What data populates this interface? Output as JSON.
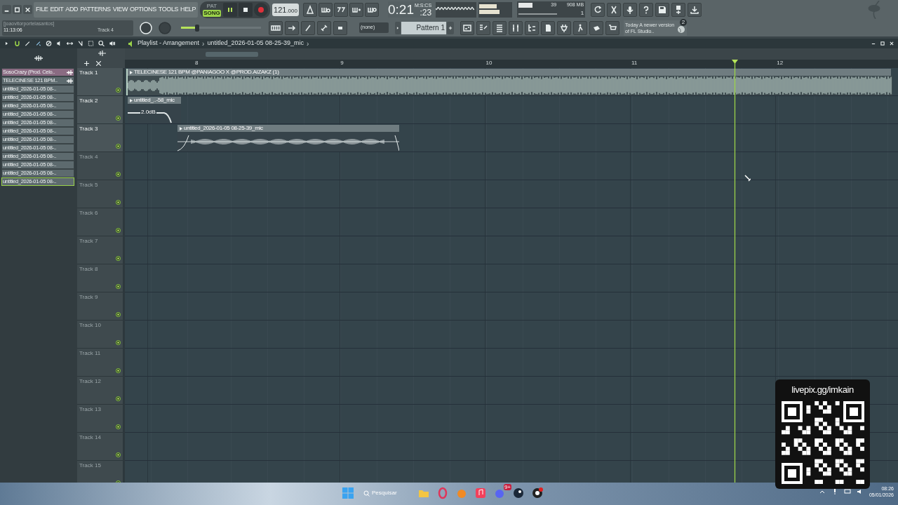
{
  "menu": [
    "FILE",
    "EDIT",
    "ADD",
    "PATTERNS",
    "VIEW",
    "OPTIONS",
    "TOOLS",
    "HELP"
  ],
  "transport": {
    "modes": [
      {
        "label": "PAT",
        "selected": false
      },
      {
        "label": "SONG",
        "selected": true
      }
    ],
    "playing": true,
    "recording": true,
    "tempo": "121",
    "tempo_fraction": ".000"
  },
  "time": {
    "value": "0:21",
    "centis": ":23",
    "unit": "M:S:CS"
  },
  "cpu": {
    "voices": "39",
    "memory": "908 MB",
    "polyphony": "1"
  },
  "info": {
    "user": "[joaovitorportelasantos]",
    "clock": "11:13:06",
    "track": "Track 4"
  },
  "master_volume": {
    "level": 0.2
  },
  "pattern": {
    "channel": "(none)",
    "name": "Pattern 1"
  },
  "hint": {
    "day": "Today",
    "message": "A newer version of FL Studio..",
    "badge": "2"
  },
  "playlist": {
    "title": "Playlist - Arrangement",
    "separators": [
      "›",
      "›"
    ],
    "clip": "untitled_2026-01-05 08-25-39_mic",
    "ruler": [
      "8",
      "9",
      "10",
      "11",
      "12"
    ],
    "picker": [
      {
        "label": "SosoCrazy (Prod. Celo..",
        "kind": "sample",
        "color": "#8a6b82",
        "selected": false
      },
      {
        "label": "TELECINESE 121 BPM..",
        "kind": "sample",
        "color": "#5d6a6e",
        "selected": false
      },
      {
        "label": "untitled_2026-01-05 08-..",
        "kind": "recording",
        "color": "#5d6a6e",
        "selected": false
      },
      {
        "label": "untitled_2026-01-05 08-..",
        "kind": "recording",
        "color": "#5d6a6e",
        "selected": false
      },
      {
        "label": "untitled_2026-01-05 08-..",
        "kind": "recording",
        "color": "#5d6a6e",
        "selected": false
      },
      {
        "label": "untitled_2026-01-05 08-..",
        "kind": "recording",
        "color": "#5d6a6e",
        "selected": false
      },
      {
        "label": "untitled_2026-01-05 08-..",
        "kind": "recording",
        "color": "#5d6a6e",
        "selected": false
      },
      {
        "label": "untitled_2026-01-05 08-..",
        "kind": "recording",
        "color": "#5d6a6e",
        "selected": false
      },
      {
        "label": "untitled_2026-01-05 08-..",
        "kind": "recording",
        "color": "#5d6a6e",
        "selected": false
      },
      {
        "label": "untitled_2026-01-05 08-..",
        "kind": "recording",
        "color": "#5d6a6e",
        "selected": false
      },
      {
        "label": "untitled_2026-01-05 08-..",
        "kind": "recording",
        "color": "#5d6a6e",
        "selected": false
      },
      {
        "label": "untitled_2026-01-05 08-..",
        "kind": "recording",
        "color": "#5d6a6e",
        "selected": false
      },
      {
        "label": "untitled_2026-01-05 08-..",
        "kind": "recording",
        "color": "#5d6a6e",
        "selected": false
      },
      {
        "label": "untitled_2026-01-05 08-..",
        "kind": "recording",
        "color": "#5d6a6e",
        "selected": true
      }
    ],
    "tracks": [
      {
        "name": "Track 1",
        "empty": false,
        "clips": [
          {
            "title": "TELECINESE 121 BPM @PANIAGOO X @PROD.AIZAKZ (1)",
            "kind": "song"
          }
        ]
      },
      {
        "name": "Track 2",
        "empty": false,
        "clips": [
          {
            "title": "untitled_..-58_mic",
            "kind": "short",
            "gain": "2.0dB"
          }
        ]
      },
      {
        "name": "Track 3",
        "empty": false,
        "clips": [
          {
            "title": "untitled_2026-01-05 08-25-39_mic",
            "kind": "voice"
          }
        ]
      },
      {
        "name": "Track 4",
        "empty": true
      },
      {
        "name": "Track 5",
        "empty": true
      },
      {
        "name": "Track 6",
        "empty": true
      },
      {
        "name": "Track 7",
        "empty": true
      },
      {
        "name": "Track 8",
        "empty": true
      },
      {
        "name": "Track 9",
        "empty": true
      },
      {
        "name": "Track 10",
        "empty": true
      },
      {
        "name": "Track 11",
        "empty": true
      },
      {
        "name": "Track 12",
        "empty": true
      },
      {
        "name": "Track 13",
        "empty": true
      },
      {
        "name": "Track 14",
        "empty": true
      },
      {
        "name": "Track 15",
        "empty": true
      }
    ]
  },
  "overlay": {
    "url": "livepix.gg/imkain"
  },
  "taskbar": {
    "search": "Pesquisar",
    "discord_badge": "9+",
    "time": "08:26",
    "date": "05/01/2026"
  }
}
